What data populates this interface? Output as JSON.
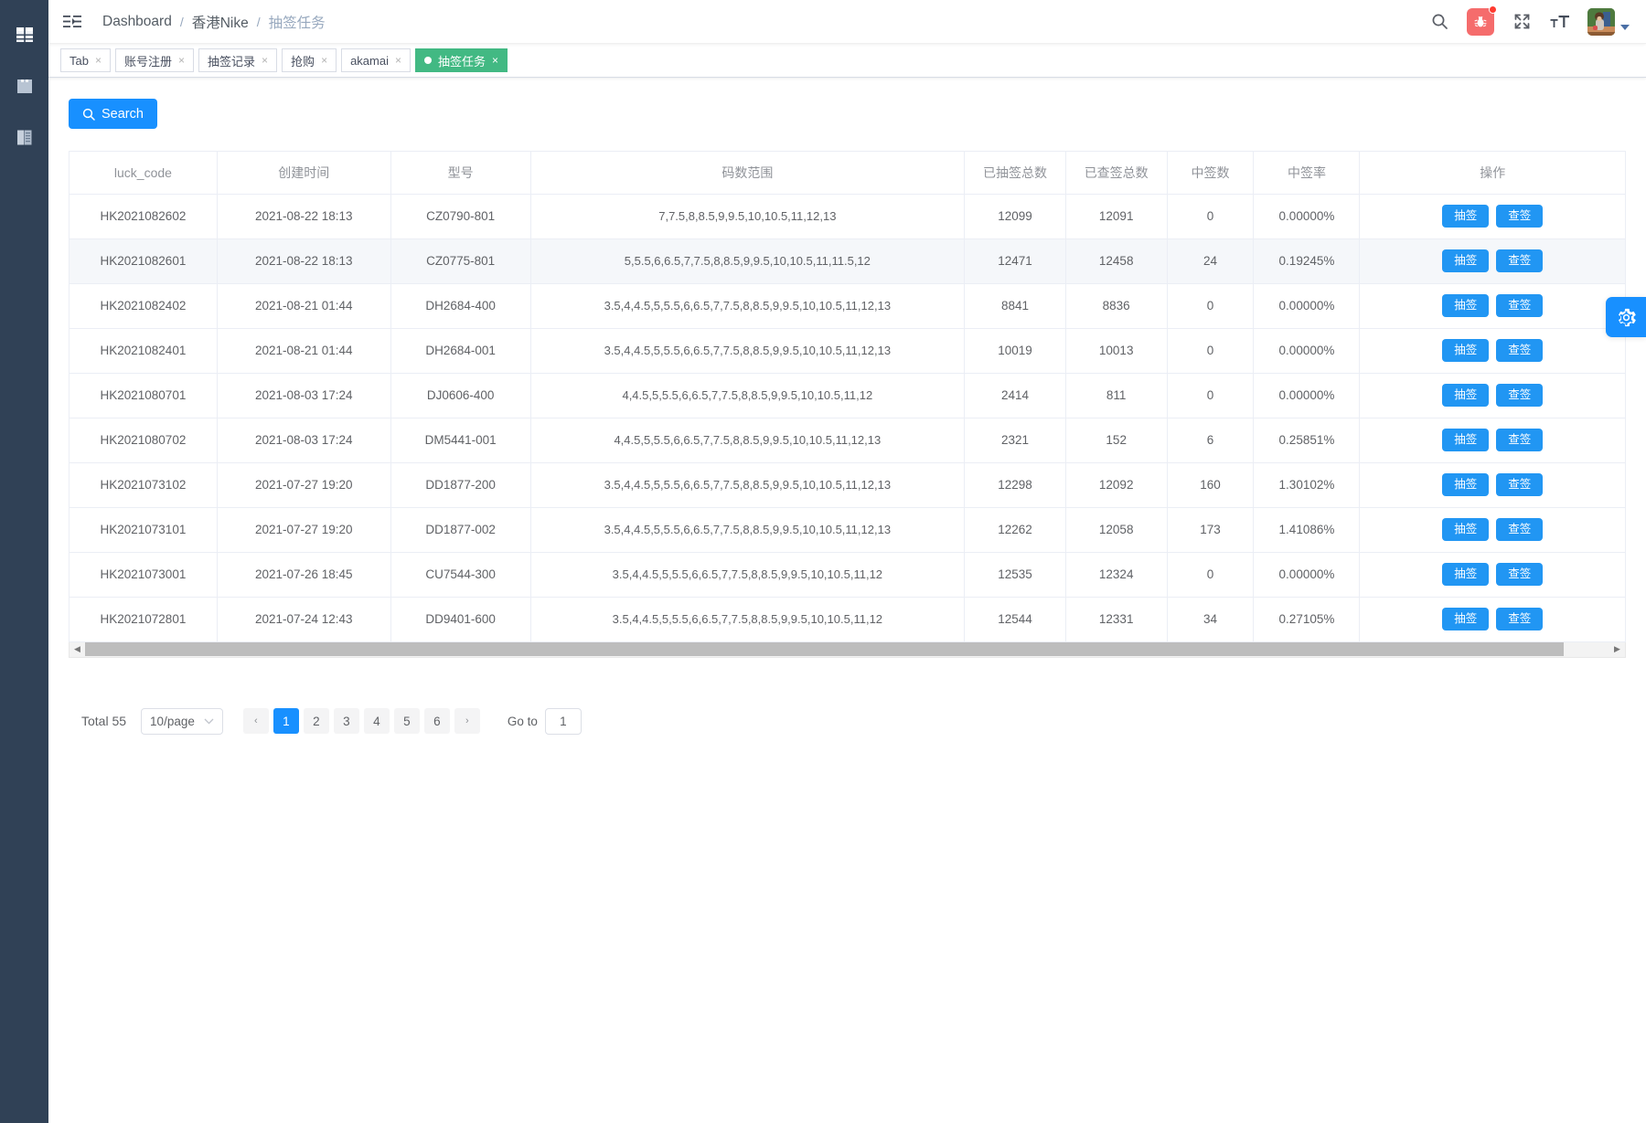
{
  "sidebar": {
    "items": [
      {
        "icon": "table-grid-icon",
        "name": "dashboard"
      },
      {
        "icon": "save-disk-icon",
        "name": "storage"
      },
      {
        "icon": "book-document-icon",
        "name": "documents"
      }
    ]
  },
  "navbar": {
    "hamburger_icon": "hamburger-menu-icon",
    "breadcrumb": [
      {
        "label": "Dashboard",
        "current": false
      },
      {
        "label": "香港Nike",
        "current": false
      },
      {
        "label": "抽签任务",
        "current": true
      }
    ],
    "separator": "/",
    "icons": [
      {
        "name": "search-icon",
        "glyph": "search"
      },
      {
        "name": "bug-icon",
        "glyph": "bug",
        "badge": true,
        "color": "#f56c6c"
      },
      {
        "name": "fullscreen-icon",
        "glyph": "fullscreen"
      },
      {
        "name": "font-size-icon",
        "glyph": "text-size"
      }
    ],
    "avatar_name": "user-avatar",
    "caret_icon": "chevron-down-icon"
  },
  "tabs": [
    {
      "label": "Tab",
      "active": false,
      "close": "×"
    },
    {
      "label": "账号注册",
      "active": false,
      "close": "×"
    },
    {
      "label": "抽签记录",
      "active": false,
      "close": "×"
    },
    {
      "label": "抢购",
      "active": false,
      "close": "×"
    },
    {
      "label": "akamai",
      "active": false,
      "close": "×"
    },
    {
      "label": "抽签任务",
      "active": true,
      "close": "×"
    }
  ],
  "toolbar": {
    "search_label": "Search",
    "search_icon": "search-icon"
  },
  "table": {
    "columns": [
      "luck_code",
      "创建时间",
      "型号",
      "码数范围",
      "已抽签总数",
      "已查签总数",
      "中签数",
      "中签率",
      "操作"
    ],
    "actions": {
      "draw": "抽签",
      "check": "查签"
    },
    "rows": [
      {
        "luck_code": "HK2021082602",
        "created": "2021-08-22 18:13",
        "model": "CZ0790-801",
        "range": "7,7.5,8,8.5,9,9.5,10,10.5,11,12,13",
        "drawn_total": "12099",
        "checked_total": "12091",
        "won": "0",
        "rate": "0.00000%",
        "hover": false
      },
      {
        "luck_code": "HK2021082601",
        "created": "2021-08-22 18:13",
        "model": "CZ0775-801",
        "range": "5,5.5,6,6.5,7,7.5,8,8.5,9,9.5,10,10.5,11,11.5,12",
        "drawn_total": "12471",
        "checked_total": "12458",
        "won": "24",
        "rate": "0.19245%",
        "hover": true
      },
      {
        "luck_code": "HK2021082402",
        "created": "2021-08-21 01:44",
        "model": "DH2684-400",
        "range": "3.5,4,4.5,5,5.5,6,6.5,7,7.5,8,8.5,9,9.5,10,10.5,11,12,13",
        "drawn_total": "8841",
        "checked_total": "8836",
        "won": "0",
        "rate": "0.00000%",
        "hover": false
      },
      {
        "luck_code": "HK2021082401",
        "created": "2021-08-21 01:44",
        "model": "DH2684-001",
        "range": "3.5,4,4.5,5,5.5,6,6.5,7,7.5,8,8.5,9,9.5,10,10.5,11,12,13",
        "drawn_total": "10019",
        "checked_total": "10013",
        "won": "0",
        "rate": "0.00000%",
        "hover": false
      },
      {
        "luck_code": "HK2021080701",
        "created": "2021-08-03 17:24",
        "model": "DJ0606-400",
        "range": "4,4.5,5,5.5,6,6.5,7,7.5,8,8.5,9,9.5,10,10.5,11,12",
        "drawn_total": "2414",
        "checked_total": "811",
        "won": "0",
        "rate": "0.00000%",
        "hover": false
      },
      {
        "luck_code": "HK2021080702",
        "created": "2021-08-03 17:24",
        "model": "DM5441-001",
        "range": "4,4.5,5,5.5,6,6.5,7,7.5,8,8.5,9,9.5,10,10.5,11,12,13",
        "drawn_total": "2321",
        "checked_total": "152",
        "won": "6",
        "rate": "0.25851%",
        "hover": false
      },
      {
        "luck_code": "HK2021073102",
        "created": "2021-07-27 19:20",
        "model": "DD1877-200",
        "range": "3.5,4,4.5,5,5.5,6,6.5,7,7.5,8,8.5,9,9.5,10,10.5,11,12,13",
        "drawn_total": "12298",
        "checked_total": "12092",
        "won": "160",
        "rate": "1.30102%",
        "hover": false
      },
      {
        "luck_code": "HK2021073101",
        "created": "2021-07-27 19:20",
        "model": "DD1877-002",
        "range": "3.5,4,4.5,5,5.5,6,6.5,7,7.5,8,8.5,9,9.5,10,10.5,11,12,13",
        "drawn_total": "12262",
        "checked_total": "12058",
        "won": "173",
        "rate": "1.41086%",
        "hover": false
      },
      {
        "luck_code": "HK2021073001",
        "created": "2021-07-26 18:45",
        "model": "CU7544-300",
        "range": "3.5,4,4.5,5,5.5,6,6.5,7,7.5,8,8.5,9,9.5,10,10.5,11,12",
        "drawn_total": "12535",
        "checked_total": "12324",
        "won": "0",
        "rate": "0.00000%",
        "hover": false
      },
      {
        "luck_code": "HK2021072801",
        "created": "2021-07-24 12:43",
        "model": "DD9401-600",
        "range": "3.5,4,4.5,5,5.5,6,6.5,7,7.5,8,8.5,9,9.5,10,10.5,11,12",
        "drawn_total": "12544",
        "checked_total": "12331",
        "won": "34",
        "rate": "0.27105%",
        "hover": false
      }
    ]
  },
  "pagination": {
    "total_label": "Total 55",
    "page_size_value": "10/page",
    "prev_glyph": "‹",
    "next_glyph": "›",
    "pages": [
      "1",
      "2",
      "3",
      "4",
      "5",
      "6"
    ],
    "active_page": "1",
    "goto_label": "Go to",
    "goto_value": "1"
  },
  "floating": {
    "gear_name": "settings-gear-icon"
  },
  "colors": {
    "primary": "#1890ff",
    "tab_active": "#42b983",
    "sidebar": "#304156",
    "danger": "#f56c6c"
  }
}
